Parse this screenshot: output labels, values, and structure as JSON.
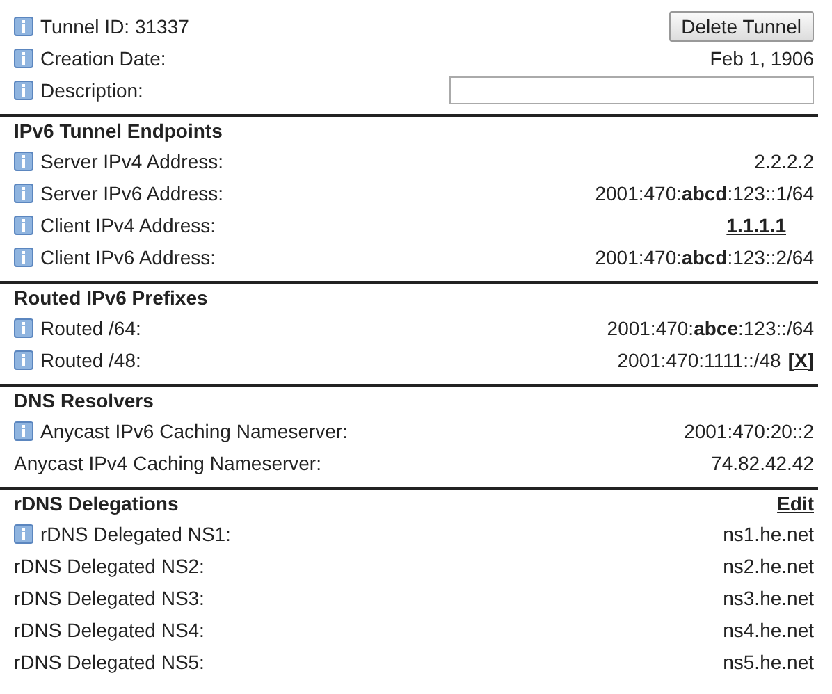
{
  "sections": [
    {
      "rows": [
        {
          "label": "Tunnel ID: 31337",
          "info": true,
          "kind": "button",
          "value": "Delete Tunnel"
        },
        {
          "label": "Creation Date:",
          "info": true,
          "kind": "text",
          "value": "Feb 1, 1906"
        },
        {
          "label": "Description:",
          "info": true,
          "kind": "field"
        }
      ]
    },
    {
      "heading": "IPv6 Tunnel Endpoints",
      "rows": [
        {
          "label": "Server IPv4 Address:",
          "info": true,
          "kind": "text",
          "value": "2.2.2.2"
        },
        {
          "label": "Server IPv6 Address:",
          "info": true,
          "kind": "text",
          "value": "2001:470:**abcd**:123::1/64"
        },
        {
          "label": "Client IPv4 Address:",
          "info": true,
          "kind": "link",
          "value": "1.1.1.1"
        },
        {
          "label": "Client IPv6 Address:",
          "info": true,
          "kind": "text",
          "value": "2001:470:**abcd**:123::2/64"
        }
      ]
    },
    {
      "heading": "Routed IPv6 Prefixes",
      "rows": [
        {
          "label": "Routed /64:",
          "info": true,
          "kind": "text",
          "value": "2001:470:**abce**:123::/64"
        },
        {
          "label": "Routed /48:",
          "info": true,
          "kind": "text",
          "value": "2001:470:1111::/48",
          "action": "[X]"
        }
      ]
    },
    {
      "heading": "DNS Resolvers",
      "rows": [
        {
          "label": "Anycast IPv6 Caching Nameserver:",
          "info": true,
          "kind": "text",
          "value": "2001:470:20::2"
        },
        {
          "label": "Anycast IPv4 Caching Nameserver:",
          "info": false,
          "kind": "text",
          "value": "74.82.42.42"
        }
      ]
    },
    {
      "heading": "rDNS Delegations",
      "action": "Edit",
      "rows": [
        {
          "label": "rDNS Delegated NS1:",
          "info": true,
          "kind": "text",
          "value": "ns1.he.net"
        },
        {
          "label": "rDNS Delegated NS2:",
          "info": false,
          "kind": "text",
          "value": "ns2.he.net"
        },
        {
          "label": "rDNS Delegated NS3:",
          "info": false,
          "kind": "text",
          "value": "ns3.he.net"
        },
        {
          "label": "rDNS Delegated NS4:",
          "info": false,
          "kind": "text",
          "value": "ns4.he.net"
        },
        {
          "label": "rDNS Delegated NS5:",
          "info": false,
          "kind": "text",
          "value": "ns5.he.net"
        }
      ]
    }
  ]
}
